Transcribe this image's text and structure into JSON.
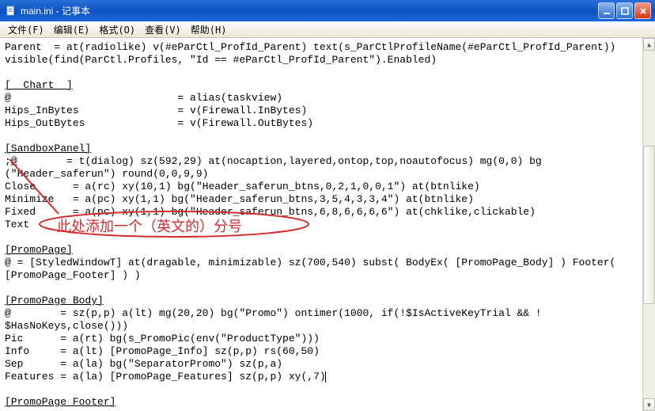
{
  "window": {
    "title": "main.ini - 记事本"
  },
  "menu": {
    "file": "文件(F)",
    "edit": "编辑(E)",
    "format": "格式(O)",
    "view": "查看(V)",
    "help": "帮助(H)"
  },
  "annotation": {
    "text": "此处添加一个（英文的）分号",
    "color": "#d22d2d"
  },
  "editor_lines": [
    "Parent  = at(radiolike) v(#eParCtl_ProfId_Parent) text(s_ParCtlProfileName(#eParCtl_ProfId_Parent))",
    "visible(find(ParCtl.Profiles, \"Id == #eParCtl_ProfId_Parent\").Enabled)",
    "",
    "[__Chart__]",
    "@                           = alias(taskview)",
    "Hips_InBytes                = v(Firewall.InBytes)",
    "Hips_OutBytes               = v(Firewall.OutBytes)",
    "",
    "[SandboxPanel]",
    ";@        = t(dialog) sz(592,29) at(nocaption,layered,ontop,top,noautofocus) mg(0,0) bg",
    "(\"Header_saferun\") round(0,0,9,9)",
    "Close      = a(rc) xy(10,1) bg(\"Header_saferun_btns,0,2,1,0,0,1\") at(btnlike)",
    "Minimize   = a(pc) xy(1,1) bg(\"Header_saferun_btns,3,5,4,3,3,4\") at(btnlike)",
    "Fixed      = a(pc) xy(1,1) bg(\"Header_saferun_btns,6,8,6,6,6,6\") at(chklike,clickable)",
    "Text       ",
    "",
    "[PromoPage]",
    "@ = [StyledWindowT] at(dragable, minimizable) sz(700,540) subst( BodyEx( [PromoPage_Body] ) Footer(",
    "[PromoPage_Footer] ) )",
    "",
    "[PromoPage_Body]",
    "@        = sz(p,p) a(lt) mg(20,20) bg(\"Promo\") ontimer(1000, if(!$IsActiveKeyTrial && !",
    "$HasNoKeys,close()))",
    "Pic      = a(rt) bg(s_PromoPic(env(\"ProductType\")))",
    "Info     = a(lt) [PromoPage_Info] sz(p,p) rs(60,50)",
    "Sep      = a(la) bg(\"SeparatorPromo\") sz(p,a)",
    "Features = a(la) [PromoPage_Features] sz(p,p) xy(,7)",
    "",
    "[PromoPage_Footer]"
  ]
}
